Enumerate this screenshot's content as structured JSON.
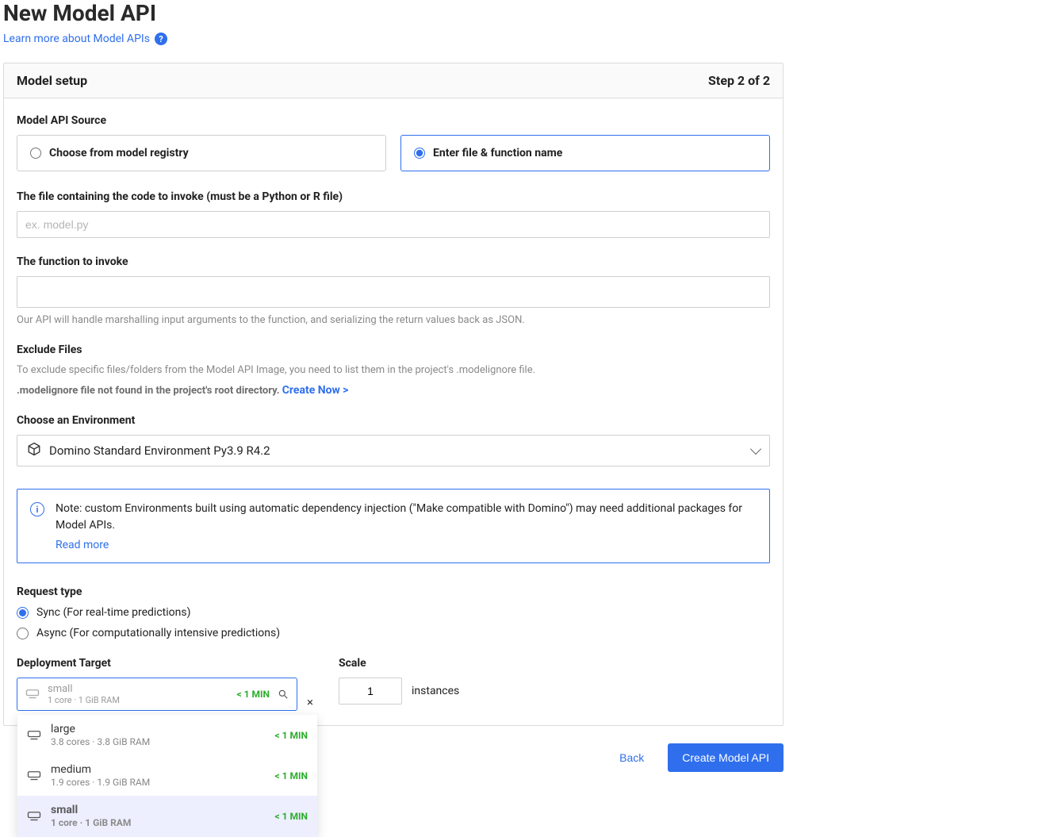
{
  "page": {
    "title": "New Model API",
    "learn_more": "Learn more about Model APIs"
  },
  "panel": {
    "title": "Model setup",
    "step": "Step 2 of 2"
  },
  "source": {
    "label": "Model API Source",
    "opt_registry": "Choose from model registry",
    "opt_file": "Enter file & function name"
  },
  "file": {
    "label": "The file containing the code to invoke (must be a Python or R file)",
    "placeholder": "ex. model.py",
    "value": ""
  },
  "func": {
    "label": "The function to invoke",
    "value": "",
    "help": "Our API will handle marshalling input arguments to the function, and serializing the return values back as JSON."
  },
  "exclude": {
    "label": "Exclude Files",
    "help": "To exclude specific files/folders from the Model API Image, you need to list them in the project's .modelignore file.",
    "notfound": ".modelignore file not found in the project's root directory. ",
    "create": "Create Now >"
  },
  "env": {
    "label": "Choose an Environment",
    "value": "Domino Standard Environment Py3.9 R4.2"
  },
  "note": {
    "text": "Note: custom Environments built using automatic dependency injection (\"Make compatible with Domino\") may need additional packages for Model APIs.",
    "read_more": "Read more"
  },
  "request": {
    "label": "Request type",
    "sync": "Sync (For real-time predictions)",
    "async": "Async (For computationally intensive predictions)"
  },
  "deploy": {
    "label": "Deployment Target",
    "selected_name": "small",
    "selected_spec": "1 core · 1 GiB RAM",
    "selected_time": "< 1 MIN",
    "options": [
      {
        "name": "large",
        "spec": "3.8 cores · 3.8 GiB RAM",
        "time": "< 1 MIN",
        "selected": false
      },
      {
        "name": "medium",
        "spec": "1.9 cores · 1.9 GiB RAM",
        "time": "< 1 MIN",
        "selected": false
      },
      {
        "name": "small",
        "spec": "1 core · 1 GiB RAM",
        "time": "< 1 MIN",
        "selected": true
      }
    ]
  },
  "scale": {
    "label": "Scale",
    "value": "1",
    "unit": "instances"
  },
  "footer": {
    "back": "Back",
    "submit": "Create Model API"
  }
}
